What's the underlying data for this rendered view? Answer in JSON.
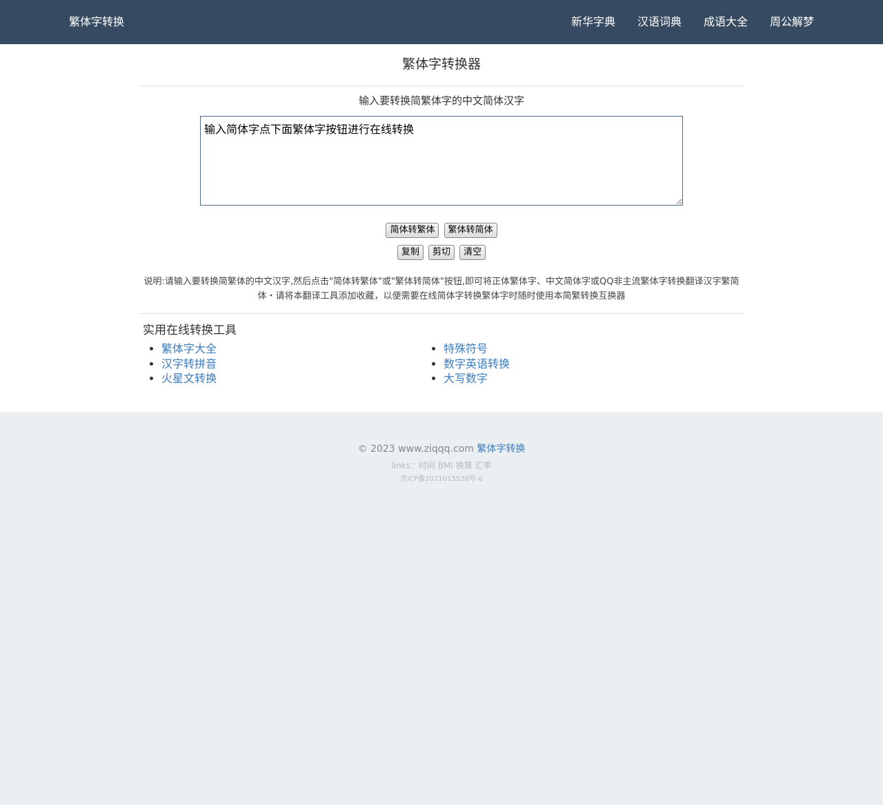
{
  "header": {
    "brand": "繁体字转换",
    "nav": [
      "新华字典",
      "汉语词典",
      "成语大全",
      "周公解梦"
    ]
  },
  "main": {
    "title": "繁体字转换器",
    "subtitle": "输入要转换简繁体字的中文简体汉字",
    "textarea_value": "输入简体字点下面繁体字按钮进行在线转换",
    "buttons_row1": [
      "简体转繁体",
      "繁体转简体"
    ],
    "buttons_row2": [
      "复制",
      "剪切",
      "清空"
    ],
    "note": "说明:请输入要转换简繁体的中文汉字,然后点击\"简体转繁体\"或\"繁体转简体\"按钮,即可将正体繁体字、中文简体字或QQ非主流繁体字转换翻译汉字繁简体・请将本翻译工具添加收藏，以便需要在线简体字转换繁体字时随时使用本简繁转换互换器"
  },
  "tools": {
    "title": "实用在线转换工具",
    "left": [
      "繁体字大全",
      "汉字转拼音",
      "火星文转换"
    ],
    "right": [
      "特殊符号",
      "数字英语转换",
      "大写数字"
    ]
  },
  "footer": {
    "copyright_prefix": "© 2023 www.ziqqq.com",
    "copyright_link": "繁体字转换",
    "links_label": "links：",
    "links": [
      "时间",
      "BMI",
      "换算",
      "汇率"
    ],
    "icp": "京ICP备2021015538号-6"
  },
  "colors": {
    "topbar": "#364b61",
    "link": "#3b7bbf",
    "footer_bg": "#ebeff1"
  }
}
